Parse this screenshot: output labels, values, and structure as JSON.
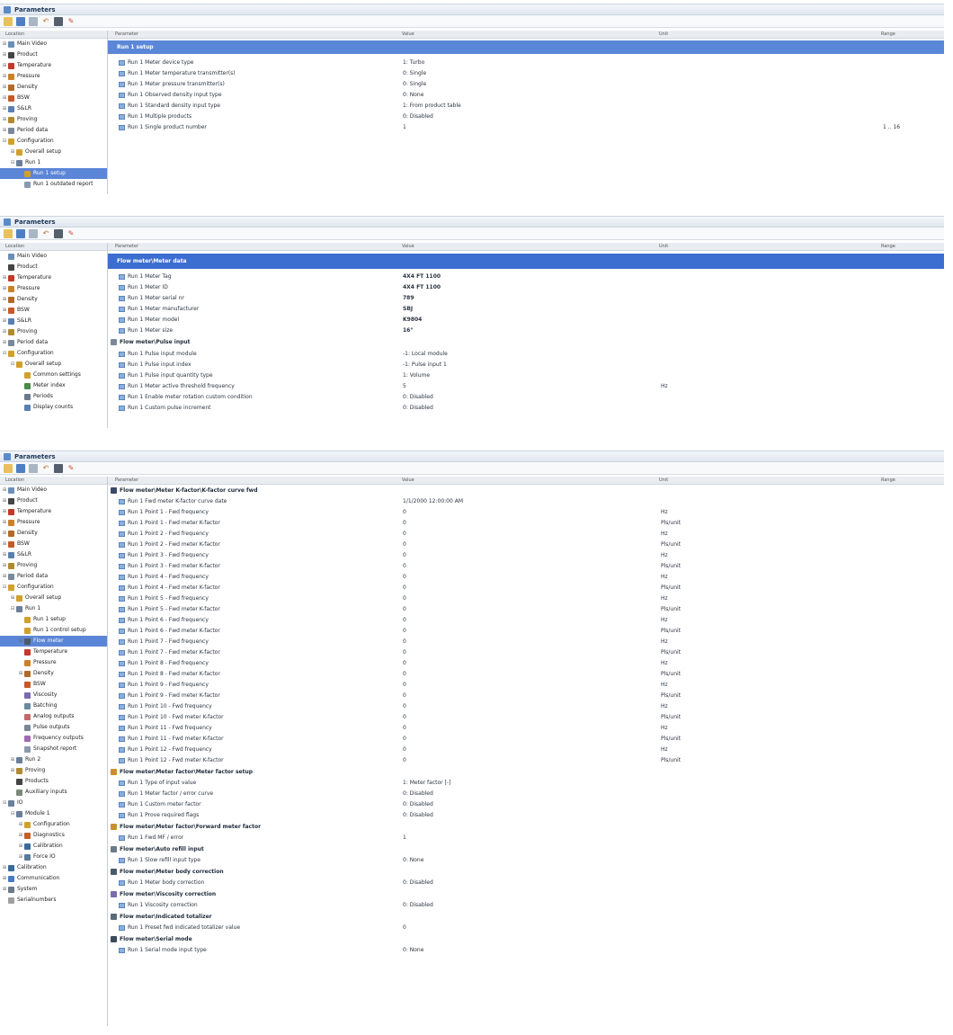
{
  "panel_title": "Parameters",
  "columns": {
    "location": "Location",
    "parameter": "Parameter",
    "value": "Value",
    "unit": "Unit",
    "range": "Range"
  },
  "colors": {
    "selection": "#5b85d6",
    "section": "#5b87d8",
    "section_dark": "#3c6ed1"
  },
  "panel1": {
    "tree": [
      {
        "label": "Main Video",
        "icon": "video-icon",
        "exp": "+",
        "indent": 0
      },
      {
        "label": "Product",
        "icon": "product-icon",
        "exp": "+",
        "indent": 0
      },
      {
        "label": "Temperature",
        "icon": "temperature-icon",
        "exp": "+",
        "indent": 0
      },
      {
        "label": "Pressure",
        "icon": "pressure-icon",
        "exp": "+",
        "indent": 0
      },
      {
        "label": "Density",
        "icon": "density-icon",
        "exp": "+",
        "indent": 0
      },
      {
        "label": "BSW",
        "icon": "bsw-icon",
        "exp": "+",
        "indent": 0
      },
      {
        "label": "S&LR",
        "icon": "slr-icon",
        "exp": "+",
        "indent": 0
      },
      {
        "label": "Proving",
        "icon": "proving-icon",
        "exp": "+",
        "indent": 0
      },
      {
        "label": "Period data",
        "icon": "period-icon",
        "exp": "+",
        "indent": 0
      },
      {
        "label": "Configuration",
        "icon": "configuration-icon",
        "exp": "-",
        "indent": 0
      },
      {
        "label": "Overall setup",
        "icon": "setup-icon",
        "exp": "+",
        "indent": 1
      },
      {
        "label": "Run 1",
        "icon": "run-icon",
        "exp": "-",
        "indent": 1
      },
      {
        "label": "Run 1 setup",
        "icon": "setup-icon",
        "exp": "",
        "indent": 2,
        "selected": true
      },
      {
        "label": "Run 1 outdated report",
        "icon": "report-icon",
        "exp": "",
        "indent": 2
      }
    ],
    "section": "Run 1 setup",
    "rows": [
      {
        "name": "Run 1 Meter device type",
        "value": "1: Turbo",
        "unit": "",
        "range": ""
      },
      {
        "name": "Run 1 Meter temperature transmitter(s)",
        "value": "0: Single",
        "unit": "",
        "range": ""
      },
      {
        "name": "Run 1 Meter pressure transmitter(s)",
        "value": "0: Single",
        "unit": "",
        "range": ""
      },
      {
        "name": "Run 1 Observed density input type",
        "value": "0: None",
        "unit": "",
        "range": ""
      },
      {
        "name": "Run 1 Standard density input type",
        "value": "1: From product table",
        "unit": "",
        "range": ""
      },
      {
        "name": "Run 1 Multiple products",
        "value": "0: Disabled",
        "unit": "",
        "range": ""
      },
      {
        "name": "Run 1 Single product number",
        "value": "1",
        "unit": "",
        "range": "1 .. 16"
      }
    ]
  },
  "panel2": {
    "tree": [
      {
        "label": "Main Video",
        "icon": "video-icon",
        "exp": "",
        "indent": 0
      },
      {
        "label": "Product",
        "icon": "product-icon",
        "exp": "",
        "indent": 0
      },
      {
        "label": "Temperature",
        "icon": "temperature-icon",
        "exp": "+",
        "indent": 0
      },
      {
        "label": "Pressure",
        "icon": "pressure-icon",
        "exp": "+",
        "indent": 0
      },
      {
        "label": "Density",
        "icon": "density-icon",
        "exp": "+",
        "indent": 0
      },
      {
        "label": "BSW",
        "icon": "bsw-icon",
        "exp": "+",
        "indent": 0
      },
      {
        "label": "S&LR",
        "icon": "slr-icon",
        "exp": "+",
        "indent": 0
      },
      {
        "label": "Proving",
        "icon": "proving-icon",
        "exp": "+",
        "indent": 0
      },
      {
        "label": "Period data",
        "icon": "period-icon",
        "exp": "+",
        "indent": 0
      },
      {
        "label": "Configuration",
        "icon": "configuration-icon",
        "exp": "-",
        "indent": 0
      },
      {
        "label": "Overall setup",
        "icon": "setup-icon",
        "exp": "-",
        "indent": 1
      },
      {
        "label": "Common settings",
        "icon": "settings-icon",
        "exp": "",
        "indent": 2
      },
      {
        "label": "Meter index",
        "icon": "index-icon",
        "exp": "",
        "indent": 2
      },
      {
        "label": "Periods",
        "icon": "periods-icon",
        "exp": "",
        "indent": 2
      },
      {
        "label": "Display counts",
        "icon": "display-icon",
        "exp": "",
        "indent": 2
      }
    ],
    "section": "Flow meter\\Meter data",
    "rows": [
      {
        "name": "Run 1 Meter Tag",
        "value": "4X4 FT 1100",
        "unit": "",
        "bold": true
      },
      {
        "name": "Run 1 Meter ID",
        "value": "4X4 FT 1100",
        "unit": "",
        "bold": true
      },
      {
        "name": "Run 1 Meter serial nr",
        "value": "789",
        "unit": "",
        "bold": true
      },
      {
        "name": "Run 1 Meter manufacturer",
        "value": "SBJ",
        "unit": "",
        "bold": true
      },
      {
        "name": "Run 1 Meter model",
        "value": "K9804",
        "unit": "",
        "bold": true
      },
      {
        "name": "Run 1 Meter size",
        "value": "16\"",
        "unit": "",
        "bold": true
      }
    ],
    "group": "Flow meter\\Pulse input",
    "rows2": [
      {
        "name": "Run 1 Pulse input module",
        "value": "-1: Local module",
        "unit": ""
      },
      {
        "name": "Run 1 Pulse input index",
        "value": "-1: Pulse input 1",
        "unit": ""
      },
      {
        "name": "Run 1 Pulse input quantity type",
        "value": "1: Volume",
        "unit": ""
      },
      {
        "name": "Run 1 Meter active threshold frequency",
        "value": "5",
        "unit": "Hz"
      },
      {
        "name": "Run 1 Enable meter rotation custom condition",
        "value": "0: Disabled",
        "unit": ""
      },
      {
        "name": "Run 1 Custom pulse increment",
        "value": "0: Disabled",
        "unit": ""
      }
    ]
  },
  "panel3": {
    "tree": [
      {
        "label": "Main Video",
        "icon": "video-icon",
        "exp": "+",
        "indent": 0
      },
      {
        "label": "Product",
        "icon": "product-icon",
        "exp": "+",
        "indent": 0
      },
      {
        "label": "Temperature",
        "icon": "temperature-icon",
        "exp": "+",
        "indent": 0
      },
      {
        "label": "Pressure",
        "icon": "pressure-icon",
        "exp": "+",
        "indent": 0
      },
      {
        "label": "Density",
        "icon": "density-icon",
        "exp": "+",
        "indent": 0
      },
      {
        "label": "BSW",
        "icon": "bsw-icon",
        "exp": "+",
        "indent": 0
      },
      {
        "label": "S&LR",
        "icon": "slr-icon",
        "exp": "+",
        "indent": 0
      },
      {
        "label": "Proving",
        "icon": "proving-icon",
        "exp": "+",
        "indent": 0
      },
      {
        "label": "Period data",
        "icon": "period-icon",
        "exp": "+",
        "indent": 0
      },
      {
        "label": "Configuration",
        "icon": "configuration-icon",
        "exp": "-",
        "indent": 0
      },
      {
        "label": "Overall setup",
        "icon": "setup-icon",
        "exp": "+",
        "indent": 1
      },
      {
        "label": "Run 1",
        "icon": "run-icon",
        "exp": "-",
        "indent": 1
      },
      {
        "label": "Run 1 setup",
        "icon": "setup-icon",
        "exp": "",
        "indent": 2
      },
      {
        "label": "Run 1 control setup",
        "icon": "setup-icon",
        "exp": "",
        "indent": 2
      },
      {
        "label": "Flow meter",
        "icon": "flow-meter-icon",
        "exp": "-",
        "indent": 2,
        "selected": true
      },
      {
        "label": "Temperature",
        "icon": "temperature-icon",
        "exp": "",
        "indent": 2
      },
      {
        "label": "Pressure",
        "icon": "pressure-icon",
        "exp": "",
        "indent": 2
      },
      {
        "label": "Density",
        "icon": "density-icon",
        "exp": "+",
        "indent": 2
      },
      {
        "label": "BSW",
        "icon": "bsw-icon",
        "exp": "",
        "indent": 2
      },
      {
        "label": "Viscosity",
        "icon": "viscosity-icon",
        "exp": "",
        "indent": 2
      },
      {
        "label": "Batching",
        "icon": "batching-icon",
        "exp": "",
        "indent": 2
      },
      {
        "label": "Analog outputs",
        "icon": "analog-icon",
        "exp": "",
        "indent": 2
      },
      {
        "label": "Pulse outputs",
        "icon": "pulse-icon",
        "exp": "",
        "indent": 2
      },
      {
        "label": "Frequency outputs",
        "icon": "frequency-icon",
        "exp": "",
        "indent": 2
      },
      {
        "label": "Snapshot report",
        "icon": "snapshot-icon",
        "exp": "",
        "indent": 2
      },
      {
        "label": "Run 2",
        "icon": "run-icon",
        "exp": "+",
        "indent": 1
      },
      {
        "label": "Proving",
        "icon": "proving-icon",
        "exp": "+",
        "indent": 1
      },
      {
        "label": "Products",
        "icon": "product-icon",
        "exp": "",
        "indent": 1
      },
      {
        "label": "Auxiliary inputs",
        "icon": "aux-icon",
        "exp": "",
        "indent": 1
      },
      {
        "label": "IO",
        "icon": "io-icon",
        "exp": "-",
        "indent": 0
      },
      {
        "label": "Module 1",
        "icon": "module-icon",
        "exp": "-",
        "indent": 1
      },
      {
        "label": "Configuration",
        "icon": "configuration-icon",
        "exp": "+",
        "indent": 2
      },
      {
        "label": "Diagnostics",
        "icon": "diagnostics-icon",
        "exp": "+",
        "indent": 2
      },
      {
        "label": "Calibration",
        "icon": "calibration-icon",
        "exp": "+",
        "indent": 2
      },
      {
        "label": "Force IO",
        "icon": "force-icon",
        "exp": "+",
        "indent": 2
      },
      {
        "label": "Calibration",
        "icon": "calibration-icon",
        "exp": "+",
        "indent": 0
      },
      {
        "label": "Communication",
        "icon": "communication-icon",
        "exp": "+",
        "indent": 0
      },
      {
        "label": "System",
        "icon": "system-icon",
        "exp": "+",
        "indent": 0
      },
      {
        "label": "Serialnumbers",
        "icon": "serial-icon",
        "exp": "",
        "indent": 0
      }
    ],
    "groups": [
      {
        "title": "Flow meter\\Meter K-factor\\K-factor curve fwd",
        "icon": "curve-icon",
        "rows": [
          {
            "name": "Run 1 Fwd meter K-factor curve date",
            "value": "1/1/2000 12:00:00 AM",
            "unit": ""
          },
          {
            "name": "Run 1 Point 1 - Fwd frequency",
            "value": "0",
            "unit": "Hz"
          },
          {
            "name": "Run 1 Point 1 - Fwd meter K-factor",
            "value": "0",
            "unit": "Pls/unit"
          },
          {
            "name": "Run 1 Point 2 - Fwd frequency",
            "value": "0",
            "unit": "Hz"
          },
          {
            "name": "Run 1 Point 2 - Fwd meter K-factor",
            "value": "0",
            "unit": "Pls/unit"
          },
          {
            "name": "Run 1 Point 3 - Fwd frequency",
            "value": "0",
            "unit": "Hz"
          },
          {
            "name": "Run 1 Point 3 - Fwd meter K-factor",
            "value": "0",
            "unit": "Pls/unit"
          },
          {
            "name": "Run 1 Point 4 - Fwd frequency",
            "value": "0",
            "unit": "Hz"
          },
          {
            "name": "Run 1 Point 4 - Fwd meter K-factor",
            "value": "0",
            "unit": "Pls/unit"
          },
          {
            "name": "Run 1 Point 5 - Fwd frequency",
            "value": "0",
            "unit": "Hz"
          },
          {
            "name": "Run 1 Point 5 - Fwd meter K-factor",
            "value": "0",
            "unit": "Pls/unit"
          },
          {
            "name": "Run 1 Point 6 - Fwd frequency",
            "value": "0",
            "unit": "Hz"
          },
          {
            "name": "Run 1 Point 6 - Fwd meter K-factor",
            "value": "0",
            "unit": "Pls/unit"
          },
          {
            "name": "Run 1 Point 7 - Fwd frequency",
            "value": "0",
            "unit": "Hz"
          },
          {
            "name": "Run 1 Point 7 - Fwd meter K-factor",
            "value": "0",
            "unit": "Pls/unit"
          },
          {
            "name": "Run 1 Point 8 - Fwd frequency",
            "value": "0",
            "unit": "Hz"
          },
          {
            "name": "Run 1 Point 8 - Fwd meter K-factor",
            "value": "0",
            "unit": "Pls/unit"
          },
          {
            "name": "Run 1 Point 9 - Fwd frequency",
            "value": "0",
            "unit": "Hz"
          },
          {
            "name": "Run 1 Point 9 - Fwd meter K-factor",
            "value": "0",
            "unit": "Pls/unit"
          },
          {
            "name": "Run 1 Point 10 - Fwd frequency",
            "value": "0",
            "unit": "Hz"
          },
          {
            "name": "Run 1 Point 10 - Fwd meter K-factor",
            "value": "0",
            "unit": "Pls/unit"
          },
          {
            "name": "Run 1 Point 11 - Fwd frequency",
            "value": "0",
            "unit": "Hz"
          },
          {
            "name": "Run 1 Point 11 - Fwd meter K-factor",
            "value": "0",
            "unit": "Pls/unit"
          },
          {
            "name": "Run 1 Point 12 - Fwd frequency",
            "value": "0",
            "unit": "Hz"
          },
          {
            "name": "Run 1 Point 12 - Fwd meter K-factor",
            "value": "0",
            "unit": "Pls/unit"
          }
        ]
      },
      {
        "title": "Flow meter\\Meter factor\\Meter factor setup",
        "icon": "meter-factor-icon",
        "rows": [
          {
            "name": "Run 1 Type of input value",
            "value": "1: Meter factor [-]",
            "unit": ""
          },
          {
            "name": "Run 1 Meter factor / error curve",
            "value": "0: Disabled",
            "unit": ""
          },
          {
            "name": "Run 1 Custom meter factor",
            "value": "0: Disabled",
            "unit": ""
          },
          {
            "name": "Run 1 Prove required flags",
            "value": "0: Disabled",
            "unit": ""
          }
        ]
      },
      {
        "title": "Flow meter\\Meter factor\\Forward meter factor",
        "icon": "meter-factor-icon",
        "rows": [
          {
            "name": "Run 1 Fwd MF / error",
            "value": "1",
            "unit": ""
          }
        ]
      },
      {
        "title": "Flow meter\\Auto refill input",
        "icon": "refill-icon",
        "rows": [
          {
            "name": "Run 1 Slow refill input type",
            "value": "0: None",
            "unit": ""
          }
        ]
      },
      {
        "title": "Flow meter\\Meter body correction",
        "icon": "body-correction-icon",
        "rows": [
          {
            "name": "Run 1 Meter body correction",
            "value": "0: Disabled",
            "unit": ""
          }
        ]
      },
      {
        "title": "Flow meter\\Viscosity correction",
        "icon": "viscosity-icon",
        "rows": [
          {
            "name": "Run 1 Viscosity correction",
            "value": "0: Disabled",
            "unit": ""
          }
        ]
      },
      {
        "title": "Flow meter\\Indicated totalizer",
        "icon": "totalizer-icon",
        "rows": [
          {
            "name": "Run 1 Preset fwd indicated totalizer value",
            "value": "0",
            "unit": ""
          }
        ]
      },
      {
        "title": "Flow meter\\Serial mode",
        "icon": "serial-mode-icon",
        "rows": [
          {
            "name": "Run 1 Serial mode input type",
            "value": "0: None",
            "unit": ""
          }
        ]
      }
    ]
  }
}
